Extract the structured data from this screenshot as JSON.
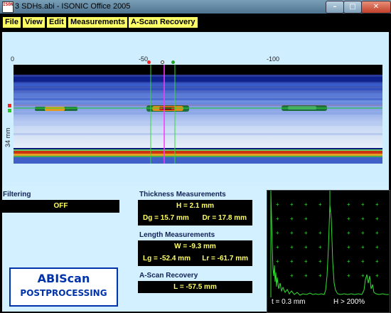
{
  "window": {
    "title": "3 SDHs.abi - ISONIC Office 2005",
    "icon_text": "ISONIC",
    "minimize_glyph": "–",
    "maximize_glyph": "□",
    "close_glyph": "✕"
  },
  "menu": {
    "items": [
      "File",
      "View",
      "Edit",
      "Measurements",
      "A-Scan Recovery"
    ]
  },
  "scan": {
    "ticks": [
      "0",
      "-50",
      "-100"
    ],
    "depth_label": "34 mm"
  },
  "filtering": {
    "label": "Filtering",
    "value": "OFF"
  },
  "thickness": {
    "title": "Thickness Measurements",
    "h": "H = 2.1 mm",
    "dg": "Dg = 15.7 mm",
    "dr": "Dr = 17.8 mm"
  },
  "length": {
    "title": "Length Measurements",
    "w": "W = -9.3 mm",
    "lg": "Lg = -52.4 mm",
    "lr": "Lr = -61.7 mm"
  },
  "ascan_recovery": {
    "title": "A-Scan Recovery",
    "l": "L = -57.5 mm"
  },
  "logo": {
    "line1": "ABIScan",
    "line2": "POSTPROCESSING"
  },
  "ascan": {
    "t": "t = 0.3 mm",
    "h": "H > 200%"
  },
  "colors": {
    "menu_bg": "#ffff66",
    "valbox_fg": "#ffff66",
    "ascan_trace": "#33ff33",
    "gate_green": "#33dd33",
    "gate_red": "#ff2222",
    "cursor_magenta": "#ff33ff"
  }
}
